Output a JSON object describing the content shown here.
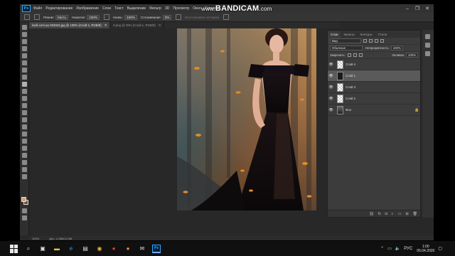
{
  "app": {
    "logo_text": "Ps",
    "menu": [
      "Файл",
      "Редактирование",
      "Изображение",
      "Слои",
      "Текст",
      "Выделение",
      "Фильтр",
      "3D",
      "Просмотр",
      "Окно",
      "Справка"
    ],
    "window_controls": [
      "–",
      "❐",
      "✕"
    ]
  },
  "watermark": {
    "prefix": "www.",
    "brand": "BANDICAM",
    "suffix": ".com"
  },
  "options": {
    "mode_label": "Режим:",
    "mode_value": "Кисть",
    "flow_label": "Нажатие:",
    "flow_value": "100%",
    "opacity_label": "Нажм.:",
    "opacity_value": "100%",
    "smoothing_label": "Сглаживание:",
    "smoothing_value": "0%",
    "restore_text": "Восстановить историю"
  },
  "document_tabs": [
    {
      "title": "lovik.com.au-304943.jpg @ 100% (Слой 1, RGB/8)",
      "close": "✕"
    },
    {
      "title": "6.png @ 25% (Слой 1, RGB/8)",
      "close": "✕"
    }
  ],
  "panel": {
    "tabs": [
      "Слои",
      "Каналы",
      "Контуры",
      "Стили"
    ],
    "filter_kind": "Вид",
    "blend_mode": "Обычные",
    "opacity_label": "Непрозрачность:",
    "opacity_value": "100%",
    "lock_label": "Закрепить:",
    "fill_label": "Заливка:",
    "fill_value": "100%",
    "layers": [
      {
        "name": "Слой 4",
        "visible_glyph": "👁",
        "thumb": "transparent",
        "selected": false
      },
      {
        "name": "Слой 1",
        "visible_glyph": "👁",
        "thumb": "mask",
        "selected": true
      },
      {
        "name": "Слой 3",
        "visible_glyph": "👁",
        "thumb": "transparent",
        "selected": false
      },
      {
        "name": "Слой 2",
        "visible_glyph": "👁",
        "thumb": "transparent",
        "selected": false
      },
      {
        "name": "Фон",
        "visible_glyph": "👁",
        "thumb": "img",
        "selected": false,
        "locked": true
      }
    ],
    "footer_icons": [
      "link-icon",
      "fx-icon",
      "mask-icon",
      "adjustment-icon",
      "folder-icon",
      "new-layer-icon",
      "trash-icon"
    ]
  },
  "status": {
    "zoom": "100%",
    "doc_info": "Док: 1,09M/11,0M"
  },
  "taskbar": {
    "icons": [
      "search-icon",
      "task-view-icon",
      "file-explorer-icon",
      "edge-icon",
      "store-icon",
      "chrome-icon",
      "yandex-icon",
      "firefox-icon",
      "mail-icon"
    ],
    "ps_label": "Ps",
    "lang": "РУС",
    "time": "1:00",
    "date": "05.04.2020"
  },
  "colors": {
    "accent": "#31a8ff",
    "panel_bg": "#3c3c3c",
    "canvas_bg": "#282828",
    "foreground_swatch": "#c8a47a",
    "background_swatch": "#7b4b2a"
  }
}
